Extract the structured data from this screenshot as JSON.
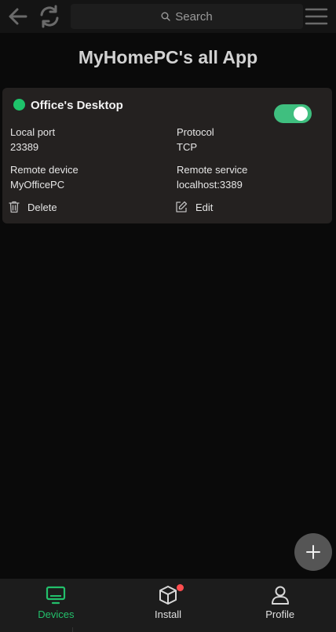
{
  "topbar": {
    "search_placeholder": "Search",
    "icons": [
      "back-arrow-icon",
      "refresh-icon",
      "search-icon",
      "hamburger-menu-icon"
    ]
  },
  "page": {
    "title": "MyHomePC's all App"
  },
  "apps": [
    {
      "name": "Office's Desktop",
      "status_color": "#1ec36a",
      "enabled": true,
      "local_port_label": "Local port",
      "local_port": "23389",
      "protocol_label": "Protocol",
      "protocol": "TCP",
      "remote_device_label": "Remote device",
      "remote_device": "MyOfficePC",
      "remote_service_label": "Remote service",
      "remote_service": "localhost:3389",
      "delete_label": "Delete",
      "edit_label": "Edit"
    }
  ],
  "bottom_nav": {
    "items": [
      {
        "label": "Devices",
        "icon": "monitor-icon",
        "active": true
      },
      {
        "label": "Install",
        "icon": "box-icon",
        "badge": true
      },
      {
        "label": "Profile",
        "icon": "user-icon"
      }
    ]
  },
  "colors": {
    "accent": "#23c06b",
    "toggle_on": "#3fbf7f",
    "badge": "#ff4d4f",
    "background": "#0a0a0a",
    "card": "#242120"
  }
}
